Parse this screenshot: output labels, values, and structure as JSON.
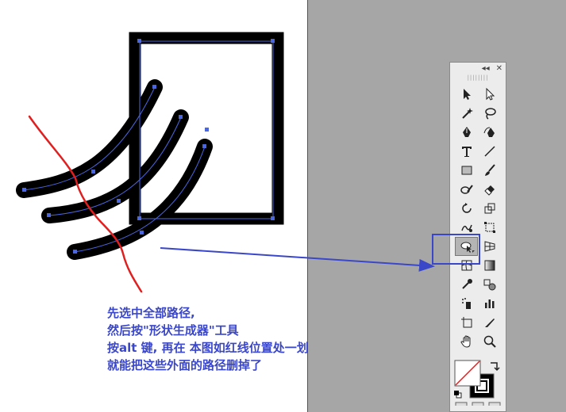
{
  "annotation": {
    "lines": [
      "先选中全部路径,",
      "然后按\"形状生成器\"工具",
      "按alt 键, 再在 本图如红线位置处一划",
      "就能把这些外面的路径删掉了"
    ]
  },
  "panel": {
    "collapse_label": "◂◂",
    "close_label": "✕",
    "grip_label": "||||||||"
  },
  "tools": [
    {
      "name": "selection-tool",
      "icon": "arrow-black-icon"
    },
    {
      "name": "direct-selection-tool",
      "icon": "arrow-white-icon"
    },
    {
      "name": "magic-wand-tool",
      "icon": "magic-wand-icon"
    },
    {
      "name": "lasso-tool",
      "icon": "lasso-icon"
    },
    {
      "name": "pen-tool",
      "icon": "pen-icon"
    },
    {
      "name": "curvature-tool",
      "icon": "curvature-pen-icon"
    },
    {
      "name": "type-tool",
      "icon": "type-icon"
    },
    {
      "name": "line-segment-tool",
      "icon": "line-icon"
    },
    {
      "name": "rectangle-tool",
      "icon": "rectangle-icon"
    },
    {
      "name": "paintbrush-tool",
      "icon": "brush-icon"
    },
    {
      "name": "shaper-tool",
      "icon": "shaper-icon"
    },
    {
      "name": "eraser-tool",
      "icon": "eraser-icon"
    },
    {
      "name": "rotate-tool",
      "icon": "rotate-icon"
    },
    {
      "name": "scale-tool",
      "icon": "scale-icon"
    },
    {
      "name": "warp-tool",
      "icon": "warp-icon"
    },
    {
      "name": "free-transform-tool",
      "icon": "free-transform-icon"
    },
    {
      "name": "shape-builder-tool",
      "icon": "shape-builder-icon"
    },
    {
      "name": "perspective-grid-tool",
      "icon": "perspective-icon"
    },
    {
      "name": "mesh-tool",
      "icon": "mesh-icon"
    },
    {
      "name": "gradient-tool",
      "icon": "gradient-icon"
    },
    {
      "name": "eyedropper-tool",
      "icon": "eyedropper-icon"
    },
    {
      "name": "blend-tool",
      "icon": "blend-icon"
    },
    {
      "name": "symbol-sprayer-tool",
      "icon": "symbol-sprayer-icon"
    },
    {
      "name": "column-graph-tool",
      "icon": "graph-icon"
    },
    {
      "name": "artboard-tool",
      "icon": "artboard-icon"
    },
    {
      "name": "slice-tool",
      "icon": "slice-icon"
    },
    {
      "name": "hand-tool",
      "icon": "hand-icon"
    },
    {
      "name": "zoom-tool",
      "icon": "zoom-icon"
    }
  ],
  "active_tool": "shape-builder-tool",
  "colors": {
    "annotation": "#3b47c9",
    "selection": "#4a66e0",
    "red_stroke": "#e02020",
    "pasteboard": "#a6a6a6"
  }
}
